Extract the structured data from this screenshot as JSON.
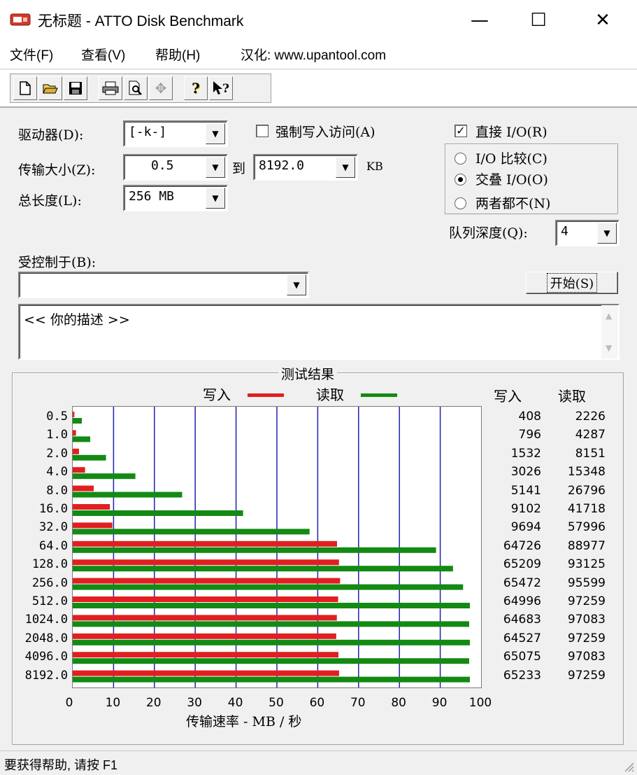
{
  "window": {
    "title": "无标题 - ATTO Disk Benchmark",
    "minimize": "—",
    "maximize": "☐",
    "close": "✕"
  },
  "menu": {
    "items": [
      "文件(F)",
      "查看(V)",
      "帮助(H)",
      "汉化: www.upantool.com"
    ]
  },
  "toolbar": {
    "buttons": [
      "new-icon",
      "open-icon",
      "save-icon",
      "print-icon",
      "preview-icon",
      "move-icon",
      "help-icon",
      "context-help-icon"
    ],
    "glyphs": [
      "🗋",
      "📂",
      "💾",
      "🖶",
      "🔍",
      "✥",
      "?",
      "?"
    ]
  },
  "form": {
    "drive_label": "驱动器(D):",
    "drive_value": "[-k-]",
    "transfer_label": "传输大小(Z):",
    "transfer_from": "0.5",
    "to_label": "到",
    "transfer_to": "8192.0",
    "unit_kb": "KB",
    "total_label": "总长度(L):",
    "total_value": "256 MB",
    "force_write_label": "强制写入访问(A)",
    "force_write_checked": false,
    "direct_io_label": "直接 I/O(R)",
    "direct_io_checked": true,
    "radio_io_compare": "I/O 比较(C)",
    "radio_overlap": "交叠 I/O(O)",
    "radio_neither": "两者都不(N)",
    "radio_selected": "overlap",
    "queue_label": "队列深度(Q):",
    "queue_value": "4",
    "controlled_label": "受控制于(B):",
    "controlled_value": "",
    "start_button": "开始(S)",
    "description": "<<  你的描述  >>"
  },
  "results": {
    "group_title": "测试结果",
    "legend_write": "写入",
    "legend_read": "读取",
    "col_write": "写入",
    "col_read": "读取",
    "write_color": "#e02020",
    "read_color": "#138a13",
    "grid_color": "#2020b0"
  },
  "chart_data": {
    "type": "bar",
    "orientation": "horizontal",
    "categories": [
      "0.5",
      "1.0",
      "2.0",
      "4.0",
      "8.0",
      "16.0",
      "32.0",
      "64.0",
      "128.0",
      "256.0",
      "512.0",
      "1024.0",
      "2048.0",
      "4096.0",
      "8192.0"
    ],
    "series": [
      {
        "name": "写入",
        "values": [
          408,
          796,
          1532,
          3026,
          5141,
          9102,
          9694,
          64726,
          65209,
          65472,
          64996,
          64683,
          64527,
          65075,
          65233
        ]
      },
      {
        "name": "读取",
        "values": [
          2226,
          4287,
          8151,
          15348,
          26796,
          41718,
          57996,
          88977,
          93125,
          95599,
          97259,
          97083,
          97259,
          97083,
          97259
        ]
      }
    ],
    "xlim": [
      0,
      100
    ],
    "x_ticks": [
      "0",
      "10",
      "20",
      "30",
      "40",
      "50",
      "60",
      "70",
      "80",
      "90",
      "100"
    ],
    "xlabel": "传输速率 - MB / 秒",
    "grid": true
  },
  "status": {
    "text": "要获得帮助, 请按 F1"
  }
}
